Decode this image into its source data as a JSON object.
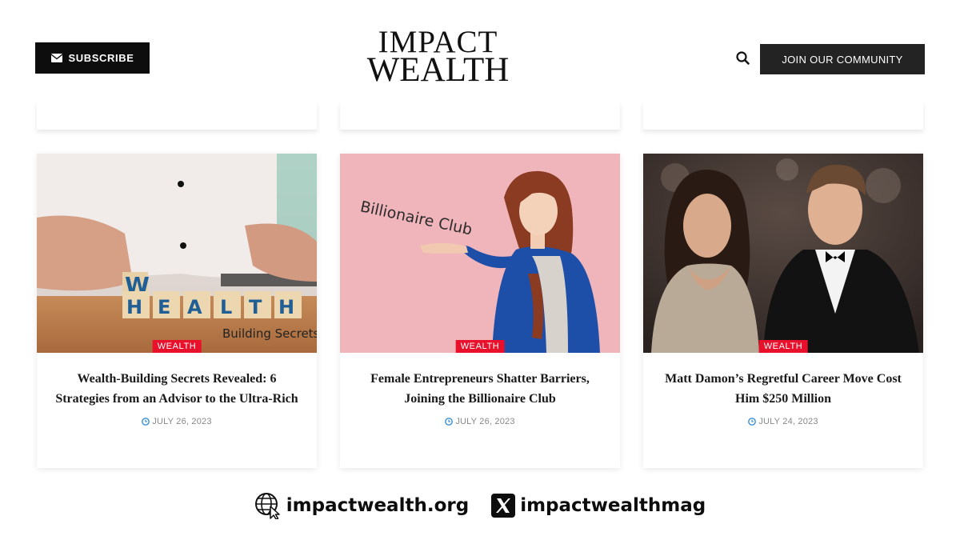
{
  "header": {
    "subscribe_label": "SUBSCRIBE",
    "logo_line1": "IMPACT",
    "logo_line2": "WEALTH",
    "join_label": "JOIN OUR COMMUNITY"
  },
  "icons": {
    "subscribe": "envelope-icon",
    "search": "search-icon",
    "date": "clock-icon",
    "website": "globe-icon",
    "social": "x-logo-icon"
  },
  "colors": {
    "tag_red": "#e8102a",
    "button_dark": "#0d0d0d",
    "join_dark": "#232323",
    "date_grey": "#888888"
  },
  "cards": [
    {
      "image_caption": "Building Secrets",
      "image_letters": "HEALTH",
      "image_top_letter": "W",
      "category": "WEALTH",
      "title": "Wealth-Building Secrets Revealed: 6 Strategies from an Advisor to the Ultra-Rich",
      "date": "JULY 26, 2023"
    },
    {
      "image_caption": "Billionaire Club",
      "category": "WEALTH",
      "title": "Female Entrepreneurs Shatter Barriers, Joining the Billionaire Club",
      "date": "JULY 26, 2023"
    },
    {
      "category": "WEALTH",
      "title": "Matt Damon’s Regretful Career Move Cost Him $250 Million",
      "date": "JULY 24, 2023"
    }
  ],
  "footer": {
    "website": "impactwealth.org",
    "social_handle": "impactwealthmag"
  }
}
